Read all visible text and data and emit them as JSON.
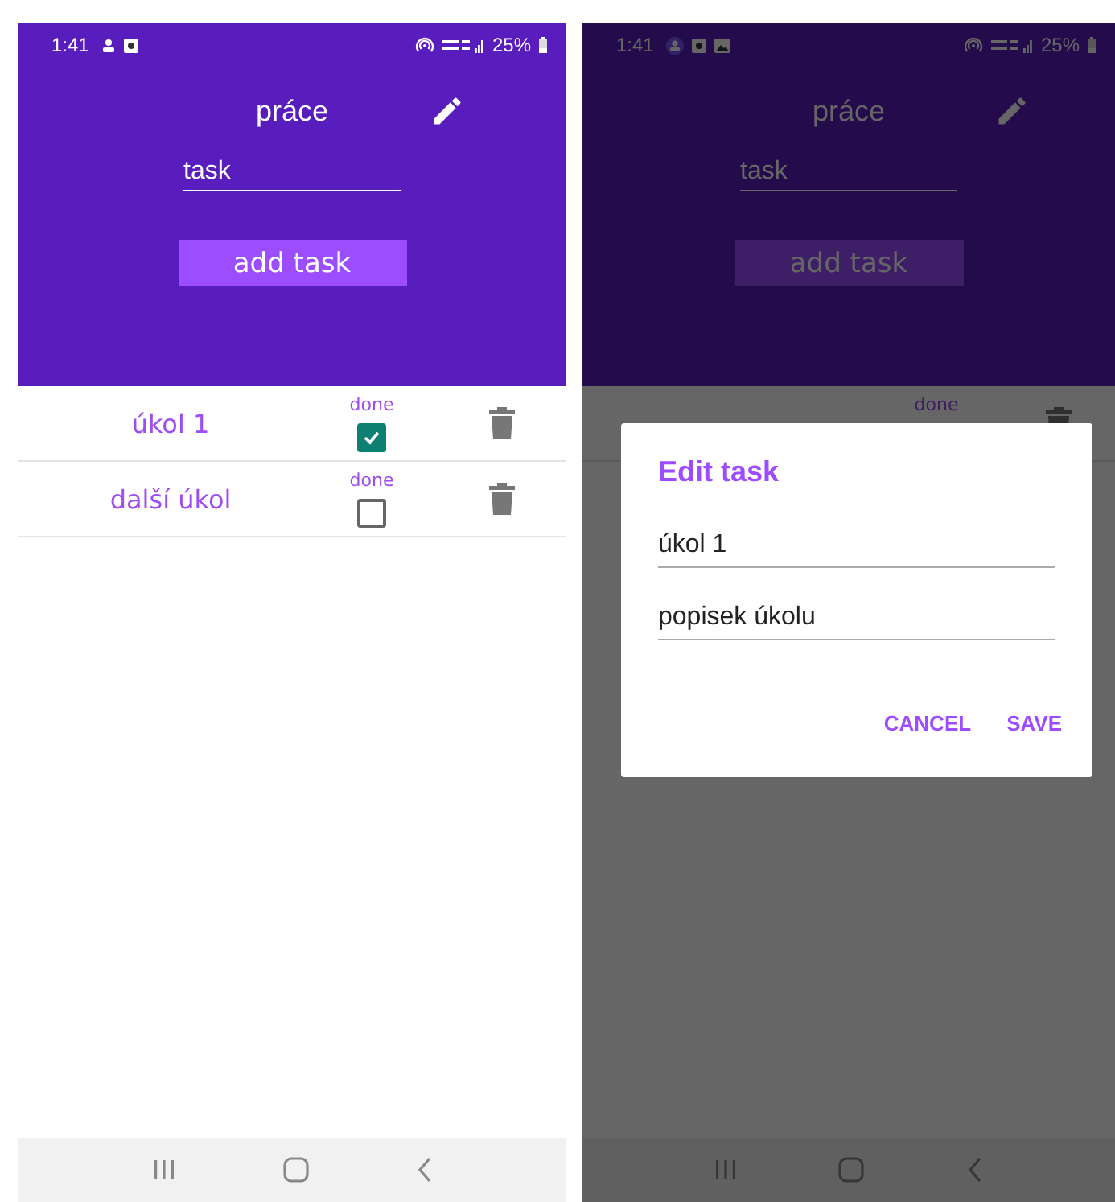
{
  "screens": [
    {
      "status_bar": {
        "time": "1:41",
        "battery": "25%"
      },
      "dimmed": false,
      "title": "práce",
      "new_task": {
        "placeholder": "task"
      },
      "add_button": "add task",
      "tasks": [
        {
          "name": "úkol 1",
          "status_label": "done",
          "done": true
        },
        {
          "name": "další úkol",
          "status_label": "done",
          "done": false
        }
      ]
    },
    {
      "status_bar": {
        "time": "1:41",
        "battery": "25%"
      },
      "dimmed": true,
      "title": "práce",
      "new_task": {
        "placeholder": "task"
      },
      "add_button": "add task",
      "tasks": [
        {
          "status_label": "done"
        }
      ],
      "dialog": {
        "title": "Edit task",
        "fields": [
          {
            "value": "úkol 1"
          },
          {
            "value": "popisek úkolu"
          }
        ],
        "buttons": [
          "CANCEL",
          "SAVE"
        ]
      }
    }
  ]
}
